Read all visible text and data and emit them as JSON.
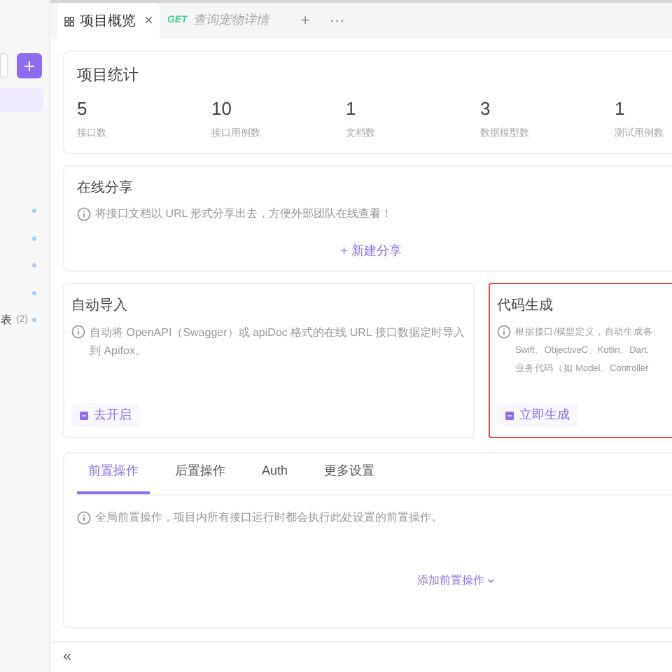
{
  "sidebar": {
    "add_button": "+",
    "items": [
      {
        "selected": true
      }
    ],
    "list_items": [
      {
        "kind": "dot"
      },
      {
        "kind": "dot"
      },
      {
        "kind": "dot"
      },
      {
        "kind": "dot"
      },
      {
        "kind": "dot",
        "label": "表",
        "count": "(2)"
      }
    ]
  },
  "tabs": [
    {
      "kind": "overview",
      "label": "项目概览",
      "close": "×",
      "selected": true
    },
    {
      "kind": "request",
      "method": "GET",
      "label": "查询宠物详情",
      "selected": false
    }
  ],
  "tab_actions": [
    "+",
    "···"
  ],
  "stats": {
    "title": "项目统计",
    "items": [
      {
        "value": "5",
        "label": "接口数"
      },
      {
        "value": "10",
        "label": "接口用例数"
      },
      {
        "value": "1",
        "label": "文档数"
      },
      {
        "value": "3",
        "label": "数据模型数"
      },
      {
        "value": "1",
        "label": "测试用例数"
      }
    ]
  },
  "share": {
    "title": "在线分享",
    "description": "将接口文档以 URL 形式分享出去，方便外部团队在线查看！",
    "action": "+ 新建分享"
  },
  "features": [
    {
      "title": "自动导入",
      "description": [
        "自动将 OpenAPI（Swagger）或 apiDoc 格式的在线 URL 接口数据定时导入到 Apifox。"
      ],
      "action": "去开启",
      "highlighted": false
    },
    {
      "title": "代码生成",
      "description": [
        "根据接口/模型定义，自动生成各",
        "Swift、ObjectiveC、Kotlin、Dart,",
        "业务代码（如 Model、Controller"
      ],
      "action": "立即生成",
      "highlighted": true
    }
  ],
  "settings": {
    "tabs": [
      {
        "label": "前置操作",
        "selected": true
      },
      {
        "label": "后置操作",
        "selected": false
      },
      {
        "label": "Auth",
        "selected": false
      },
      {
        "label": "更多设置",
        "selected": false
      }
    ],
    "info": "全局前置操作，项目内所有接口运行时都会执行此处设置的前置操作。",
    "action": "添加前置操作"
  },
  "footer": {
    "collapse": "«"
  }
}
